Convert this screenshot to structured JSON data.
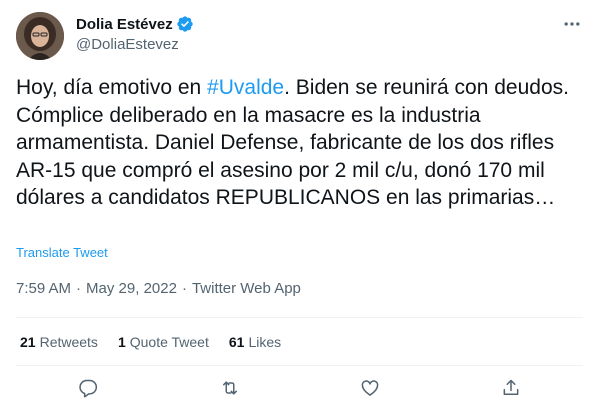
{
  "author": {
    "display_name": "Dolia Estévez",
    "handle": "@DoliaEstevez",
    "verified": true
  },
  "tweet": {
    "text_before_hashtag": "Hoy, día emotivo en ",
    "hashtag": "#Uvalde",
    "text_after_hashtag": ". Biden se reunirá con deudos. Cómplice deliberado en la masacre es la industria armamentista. Daniel Defense, fabricante de los dos rifles AR-15 que compró el asesino por 2 mil c/u, donó 170 mil dólares a candidatos REPUBLICANOS en las primarias…",
    "translate_label": "Translate Tweet"
  },
  "meta": {
    "time": "7:59 AM",
    "separator": "·",
    "date": "May 29, 2022",
    "source": "Twitter Web App"
  },
  "stats": {
    "retweets_count": "21",
    "retweets_label": "Retweets",
    "quotes_count": "1",
    "quotes_label": "Quote Tweet",
    "likes_count": "61",
    "likes_label": "Likes"
  },
  "icons": {
    "more": "more-dots-icon",
    "reply": "reply-icon",
    "retweet": "retweet-icon",
    "like": "heart-icon",
    "share": "share-icon",
    "verified": "verified-badge-icon"
  },
  "colors": {
    "accent": "#1d9bf0",
    "text": "#0f1419",
    "secondary": "#536471",
    "divider": "#eff3f4"
  }
}
